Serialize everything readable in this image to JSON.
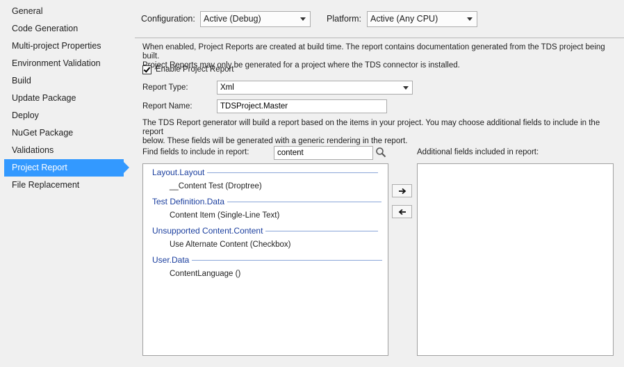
{
  "sidebar": {
    "items": [
      {
        "label": "General",
        "active": false
      },
      {
        "label": "Code Generation",
        "active": false
      },
      {
        "label": "Multi-project Properties",
        "active": false
      },
      {
        "label": "Environment Validation",
        "active": false
      },
      {
        "label": "Build",
        "active": false
      },
      {
        "label": "Update Package",
        "active": false
      },
      {
        "label": "Deploy",
        "active": false
      },
      {
        "label": "NuGet Package",
        "active": false
      },
      {
        "label": "Validations",
        "active": false
      },
      {
        "label": "Project Report",
        "active": true
      },
      {
        "label": "File Replacement",
        "active": false
      }
    ]
  },
  "config": {
    "configuration_label": "Configuration:",
    "configuration_value": "Active (Debug)",
    "platform_label": "Platform:",
    "platform_value": "Active (Any CPU)"
  },
  "report": {
    "description_line1": "When enabled, Project Reports are created at build time. The report contains documentation generated from the TDS project being built.",
    "description_line2": "Project Reports may only be generated for a project where the TDS connector is installed.",
    "enable_label": "Enable Project Report",
    "enable_checked": true,
    "type_label": "Report Type:",
    "type_value": "Xml",
    "name_label": "Report Name:",
    "name_value": "TDSProject.Master",
    "generator_line1": "The TDS Report generator will build a report based on the items in your project. You may choose additional fields to include in the report",
    "generator_line2": "below. These fields will be generated with a generic rendering in the report.",
    "find_label": "Find fields to include in report:",
    "find_value": "content",
    "additional_label": "Additional fields included in report:"
  },
  "field_groups": [
    {
      "header": "Layout.Layout",
      "item": "__Content Test (Droptree)"
    },
    {
      "header": "Test Definition.Data",
      "item": "Content Item (Single-Line Text)"
    },
    {
      "header": "Unsupported Content.Content",
      "item": "Use Alternate Content (Checkbox)"
    },
    {
      "header": "User.Data",
      "item": "ContentLanguage ()"
    }
  ],
  "buttons": {
    "add_glyph": "🡒",
    "remove_glyph": "🡐"
  },
  "colors": {
    "accent": "#3399ff",
    "group_header": "#1a3e9e"
  }
}
